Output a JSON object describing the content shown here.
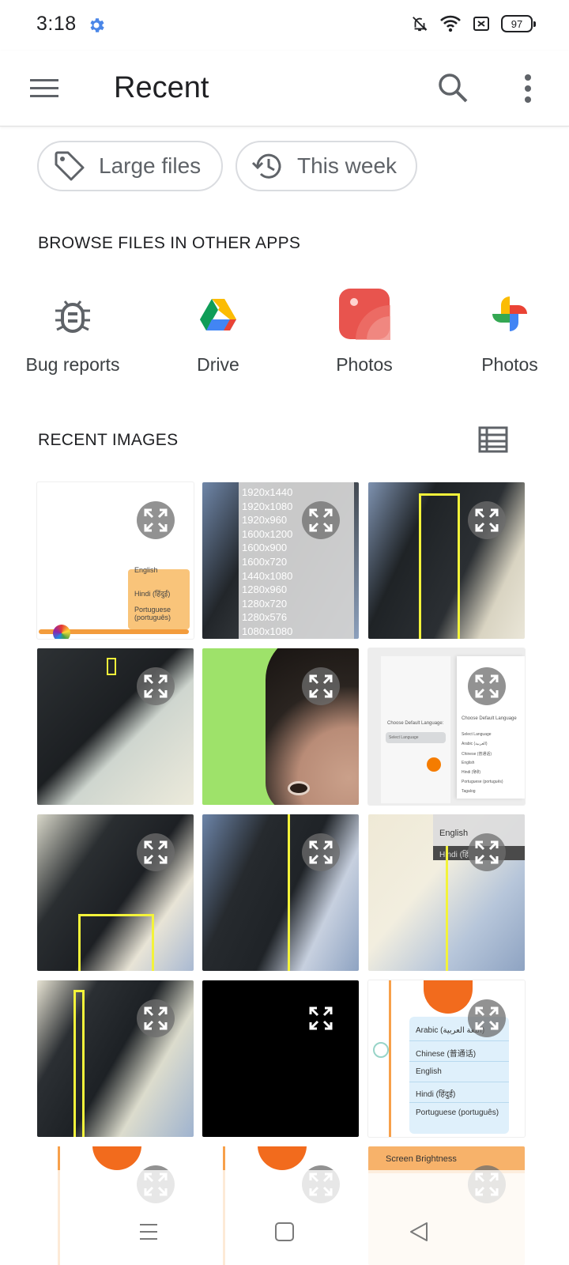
{
  "status": {
    "time": "3:18",
    "battery": "97"
  },
  "app_bar": {
    "title": "Recent"
  },
  "chips": [
    {
      "label": "Large files",
      "icon": "tag-icon"
    },
    {
      "label": "This week",
      "icon": "history-icon"
    }
  ],
  "browse": {
    "header": "BROWSE FILES IN OTHER APPS",
    "apps": [
      {
        "label": "Bug reports",
        "icon": "bug-icon"
      },
      {
        "label": "Drive",
        "icon": "google-drive-icon"
      },
      {
        "label": "Photos",
        "icon": "photos-gallery-icon"
      },
      {
        "label": "Photos",
        "icon": "google-photos-icon"
      }
    ]
  },
  "recent_images": {
    "header": "RECENT IMAGES",
    "tiles": [
      {
        "lines": [
          "English",
          "Hindi (हिंदुई)",
          "Portuguese (português)"
        ]
      },
      {
        "lines": [
          "1920x1440",
          "1920x1080",
          "1920x960",
          "1600x1200",
          "1600x900",
          "1600x720",
          "1440x1080",
          "1280x960",
          "1280x720",
          "1280x576",
          "1080x1080"
        ]
      },
      {
        "lines": []
      },
      {
        "lines": []
      },
      {
        "lines": []
      },
      {
        "lines": [
          "Choose Default Language:",
          "Select Language",
          "Choose Default Language",
          "Select Language",
          "Arabic (العربية)",
          "Chinese (普通话)",
          "English",
          "Hindi (हिंदी)",
          "Portuguese (português)",
          "Tagalog"
        ]
      },
      {
        "lines": []
      },
      {
        "lines": []
      },
      {
        "lines": [
          "English",
          "Hindi (हिं"
        ]
      },
      {
        "lines": []
      },
      {
        "lines": []
      },
      {
        "lines": [
          "Arabic (اللغة العربية)",
          "Chinese (普通话)",
          "English",
          "Hindi (हिंदुई)",
          "Portuguese (português)"
        ]
      },
      {
        "lines": []
      },
      {
        "lines": []
      },
      {
        "lines": [
          "Screen Brightness"
        ]
      }
    ]
  }
}
